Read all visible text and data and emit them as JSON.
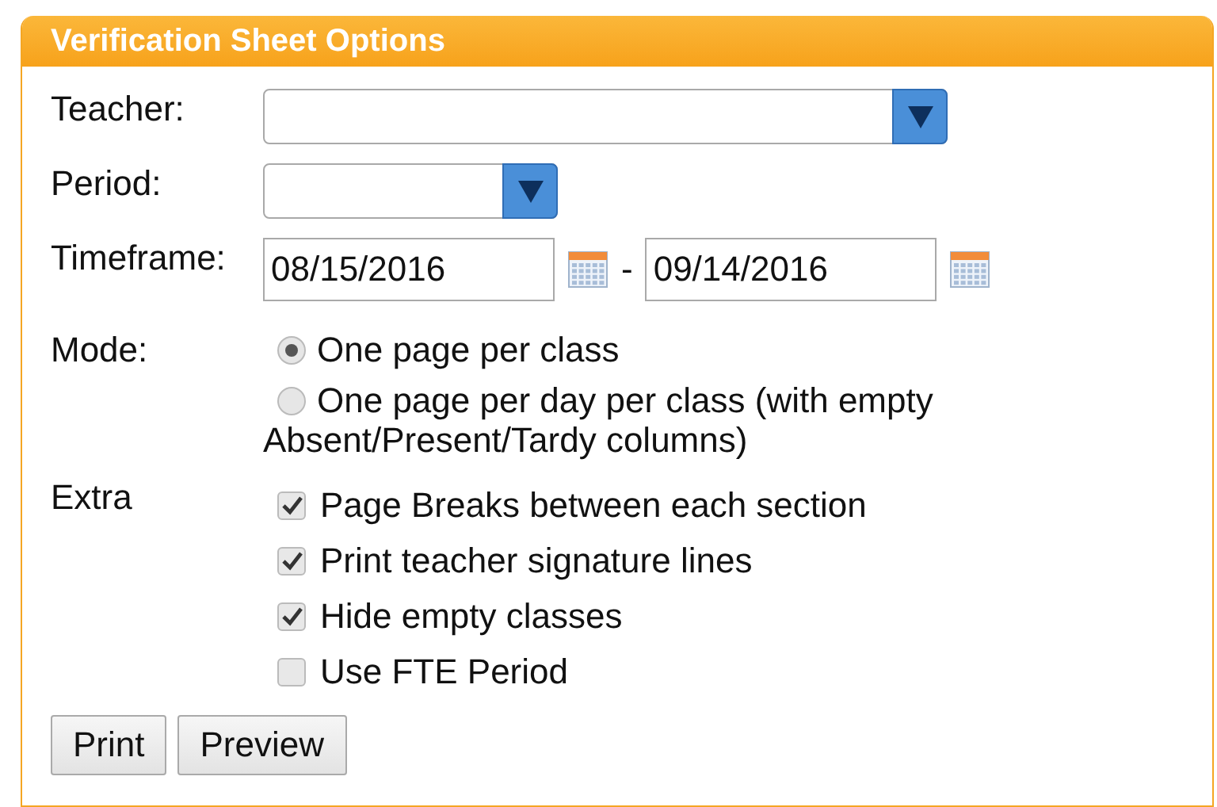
{
  "panel": {
    "title": "Verification Sheet Options"
  },
  "teacher": {
    "label": "Teacher:"
  },
  "period": {
    "label": "Period:"
  },
  "timeframe": {
    "label": "Timeframe:",
    "start": "08/15/2016",
    "separator": "-",
    "end": "09/14/2016"
  },
  "mode": {
    "label": "Mode:",
    "options": [
      {
        "label": "One page per class",
        "selected": true
      },
      {
        "label": "One page per day per class (with empty Absent/Present/Tardy columns)",
        "selected": false
      }
    ]
  },
  "extra": {
    "label": "Extra",
    "options": [
      {
        "label": "Page Breaks between each section",
        "checked": true
      },
      {
        "label": "Print teacher signature lines",
        "checked": true
      },
      {
        "label": "Hide empty classes",
        "checked": true
      },
      {
        "label": "Use FTE Period",
        "checked": false
      }
    ]
  },
  "buttons": [
    "Print",
    "Preview"
  ]
}
